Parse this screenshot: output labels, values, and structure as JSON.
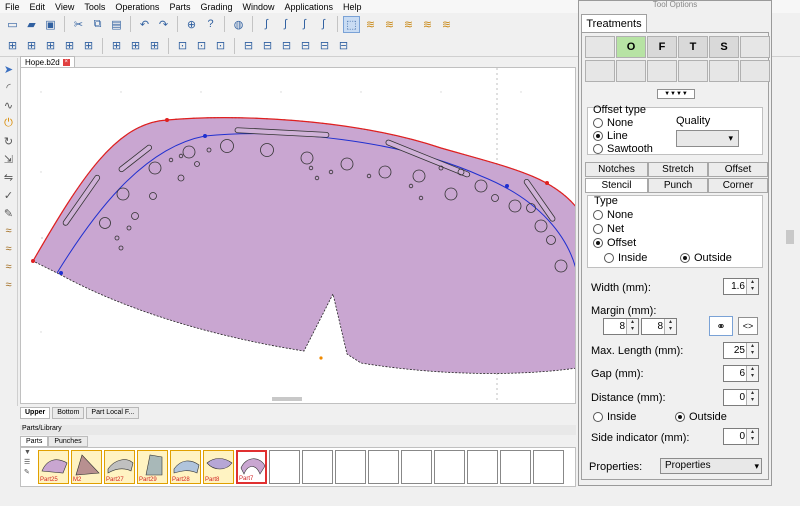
{
  "menu": [
    "File",
    "Edit",
    "View",
    "Tools",
    "Operations",
    "Parts",
    "Grading",
    "Window",
    "Applications",
    "Help"
  ],
  "document_tab": "Hope.b2d",
  "layer_tabs": [
    "Upper",
    "Bottom",
    "Part Local F..."
  ],
  "parts_library": {
    "title": "Parts/Library",
    "tabs": [
      "Parts",
      "Punches"
    ],
    "parts": [
      {
        "label": "Part25"
      },
      {
        "label": "M2"
      },
      {
        "label": "Part27"
      },
      {
        "label": "Part29"
      },
      {
        "label": "Part28"
      },
      {
        "label": "Part8"
      },
      {
        "label": "Part7"
      }
    ]
  },
  "tool_options": {
    "title": "Tool Options",
    "main_tab": "Treatments",
    "treatment_buttons": [
      "O",
      "F",
      "T",
      "S"
    ],
    "offset_type": {
      "label": "Offset type",
      "options": [
        "None",
        "Line",
        "Sawtooth"
      ],
      "selected": "Line",
      "quality_label": "Quality"
    },
    "subtabs_row1": [
      "Notches",
      "Stretch",
      "Offset"
    ],
    "subtabs_row2": [
      "Stencil",
      "Punch",
      "Corner"
    ],
    "active_subtab": "Stencil",
    "type": {
      "label": "Type",
      "options": [
        "None",
        "Net",
        "Offset"
      ],
      "selected": "Offset",
      "side_options": [
        "Inside",
        "Outside"
      ],
      "side_selected": "Outside"
    },
    "width": {
      "label": "Width (mm):",
      "value": "1.6"
    },
    "margin": {
      "label": "Margin (mm):",
      "value1": "8",
      "value2": "8"
    },
    "max_length": {
      "label": "Max. Length (mm):",
      "value": "25"
    },
    "gap": {
      "label": "Gap (mm):",
      "value": "6"
    },
    "distance": {
      "label": "Distance (mm):",
      "value": "0",
      "options": [
        "Inside",
        "Outside"
      ],
      "selected": "Outside"
    },
    "side_indicator": {
      "label": "Side indicator (mm):",
      "value": "0"
    },
    "properties": {
      "label": "Properties:",
      "value": "Properties"
    }
  }
}
